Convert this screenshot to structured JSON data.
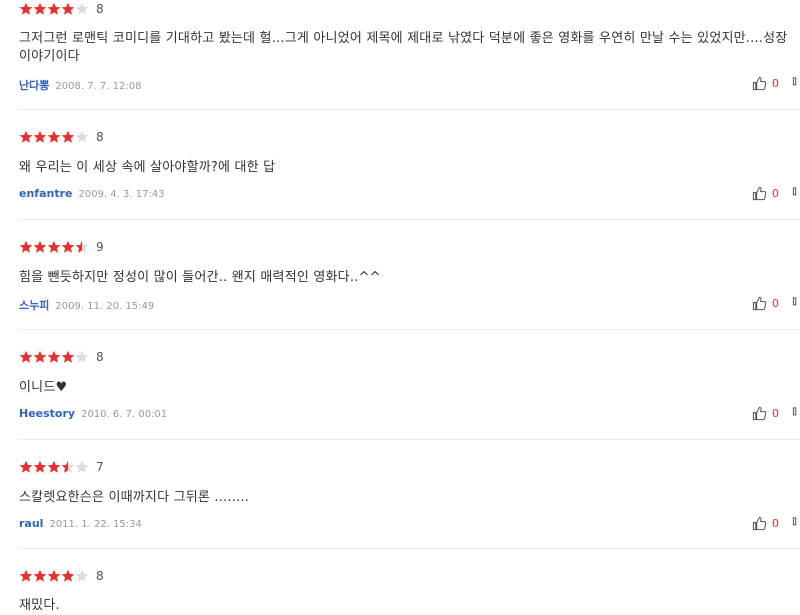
{
  "colors": {
    "star_on": "#e8312e",
    "star_off": "#dcdcdc",
    "author": "#2e63c2",
    "like_count": "#e8312e"
  },
  "reviews": [
    {
      "rating": 4,
      "score": "8",
      "text": "그저그런 로맨틱 코미디를 기대하고 봤는데 헐...그게 아니었어 제목에 제대로 낚였다 덕분에 좋은 영화를 우연히 만날 수는 있었지만....성장이야기이다",
      "author": "난다뽕",
      "date": "2008. 7. 7. 12:08",
      "likes": "0"
    },
    {
      "rating": 4,
      "score": "8",
      "text": "왜 우리는 이 세상 속에 살아야할까?에 대한 답",
      "author": "enfantre",
      "date": "2009. 4. 3. 17:43",
      "likes": "0"
    },
    {
      "rating": 4.5,
      "score": "9",
      "text": "힘을 뺀듯하지만 정성이 많이 들어간.. 왠지 매력적인 영화다..^^",
      "author": "스누피",
      "date": "2009. 11. 20. 15:49",
      "likes": "0"
    },
    {
      "rating": 4,
      "score": "8",
      "text": "이니드♥",
      "author": "Heestory",
      "date": "2010. 6. 7. 00:01",
      "likes": "0"
    },
    {
      "rating": 3.5,
      "score": "7",
      "text": "스칼렛요한슨은 이때까지다 그뒤론 ........",
      "author": "raul",
      "date": "2011. 1. 22. 15:34",
      "likes": "0"
    },
    {
      "rating": 4,
      "score": "8",
      "text": "재밌다.",
      "author": "",
      "date": "",
      "likes": ""
    }
  ]
}
